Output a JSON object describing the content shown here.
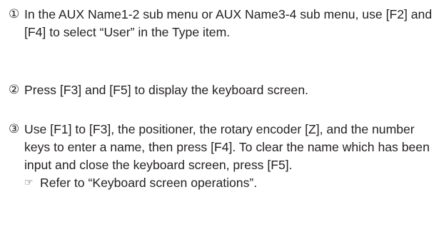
{
  "steps": [
    {
      "number": "①",
      "text": "In the AUX Name1-2 sub menu or AUX Name3-4 sub menu, use [F2] and [F4] to select “User” in the Type item."
    },
    {
      "number": "②",
      "text": "Press [F3] and [F5] to display the keyboard screen."
    },
    {
      "number": "③",
      "text": "Use [F1] to [F3], the positioner, the rotary encoder [Z], and the number keys to enter a name, then press [F4]. To clear the name which has been input and close the keyboard screen, press [F5].",
      "reference_icon": "pointing-hand-icon",
      "reference": "Refer to “Keyboard screen operations”."
    }
  ]
}
